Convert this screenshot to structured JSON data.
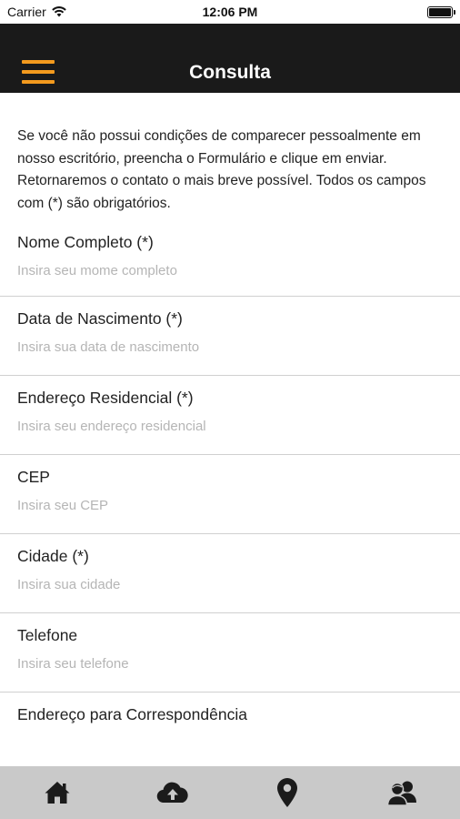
{
  "status_bar": {
    "carrier": "Carrier",
    "time": "12:06 PM"
  },
  "nav": {
    "title": "Consulta",
    "accent_color": "#f39a1e",
    "background_color": "#1a1a1a"
  },
  "intro": {
    "line1": "Se você não possui condições de comparecer pessoalmente em nosso escritório, preencha o Formulário e clique em enviar.",
    "line2": "Retornaremos o contato o mais breve possível. Todos os campos com (*) são obrigatórios."
  },
  "fields": [
    {
      "label": "Nome Completo (*)",
      "placeholder": "Insira seu mome completo",
      "value": ""
    },
    {
      "label": "Data de Nascimento (*)",
      "placeholder": "Insira sua data de nascimento",
      "value": ""
    },
    {
      "label": "Endereço Residencial (*)",
      "placeholder": "Insira seu endereço residencial",
      "value": ""
    },
    {
      "label": "CEP",
      "placeholder": "Insira seu CEP",
      "value": ""
    },
    {
      "label": "Cidade (*)",
      "placeholder": "Insira sua cidade",
      "value": ""
    },
    {
      "label": "Telefone",
      "placeholder": "Insira seu telefone",
      "value": ""
    },
    {
      "label": "Endereço para Correspondência",
      "placeholder": "",
      "value": ""
    }
  ],
  "tab_bar": {
    "tabs": [
      {
        "icon": "home-icon"
      },
      {
        "icon": "cloud-upload-icon"
      },
      {
        "icon": "map-pin-icon"
      },
      {
        "icon": "users-icon"
      }
    ]
  }
}
